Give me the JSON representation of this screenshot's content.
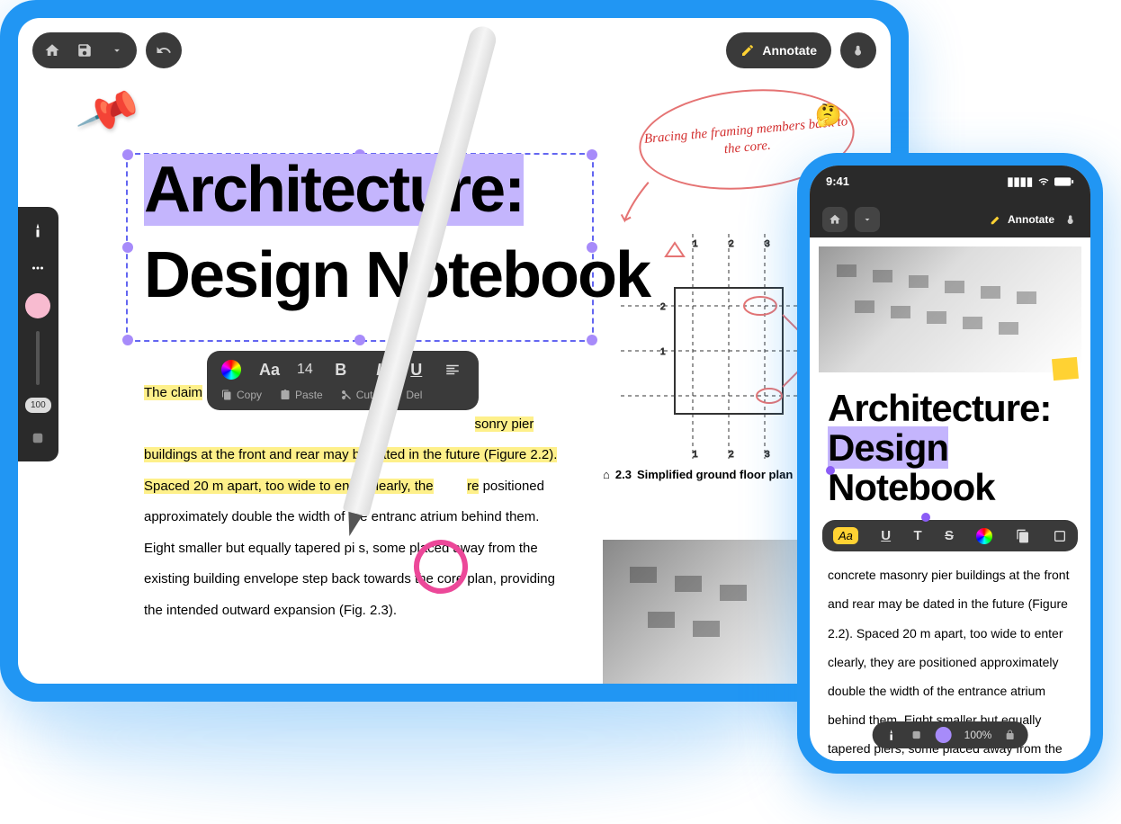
{
  "tablet": {
    "toolbar": {
      "annotate_label": "Annotate"
    },
    "zoom": "100",
    "document": {
      "title": "Architecture:",
      "subtitle": "Design Notebook",
      "body_highlighted_1": "The claim ",
      "body_highlighted_2": "sonry pier buildings at the front and rear may be dated in the future (Figure 2.2). Spaced 20 m apart, too wide to enter clearly, the",
      "body_highlighted_3": "re",
      "body_plain": " positioned approximately double the width of the entranc atrium behind them. Eight smaller but equally tapered pi     s, some placed away from the existing building envelope step back towards the core plan, providing the intended outward expansion (Fig. 2.3)."
    },
    "context_toolbar": {
      "font_family": "Aa",
      "font_size": "14",
      "bold": "B",
      "italic": "I",
      "underline": "U",
      "copy": "Copy",
      "paste": "Paste",
      "cut": "Cut",
      "del": "Del"
    },
    "annotation_bubble": "Bracing the framing members back to the core.",
    "floor_plan_caption_num": "2.3",
    "floor_plan_caption": "Simplified ground floor plan"
  },
  "phone": {
    "status_time": "9:41",
    "toolbar": {
      "annotate_label": "Annotate"
    },
    "document": {
      "title": "Architecture:",
      "subtitle_selected": "Design",
      "subtitle_rest": " Notebook",
      "body": "concrete masonry pier buildings at the front and rear may be dated in the future (Figure 2.2). Spaced 20 m apart, too wide to enter clearly, they are positioned approximately double the width of the entrance atrium behind them. Eight smaller but equally tapered piers, some placed away from the existing building envelope step back towards t"
    },
    "fmt_bar": {
      "aa": "Aa",
      "underline": "U",
      "text": "T",
      "strike": "S"
    },
    "bottom_bar": {
      "zoom": "100%"
    }
  }
}
